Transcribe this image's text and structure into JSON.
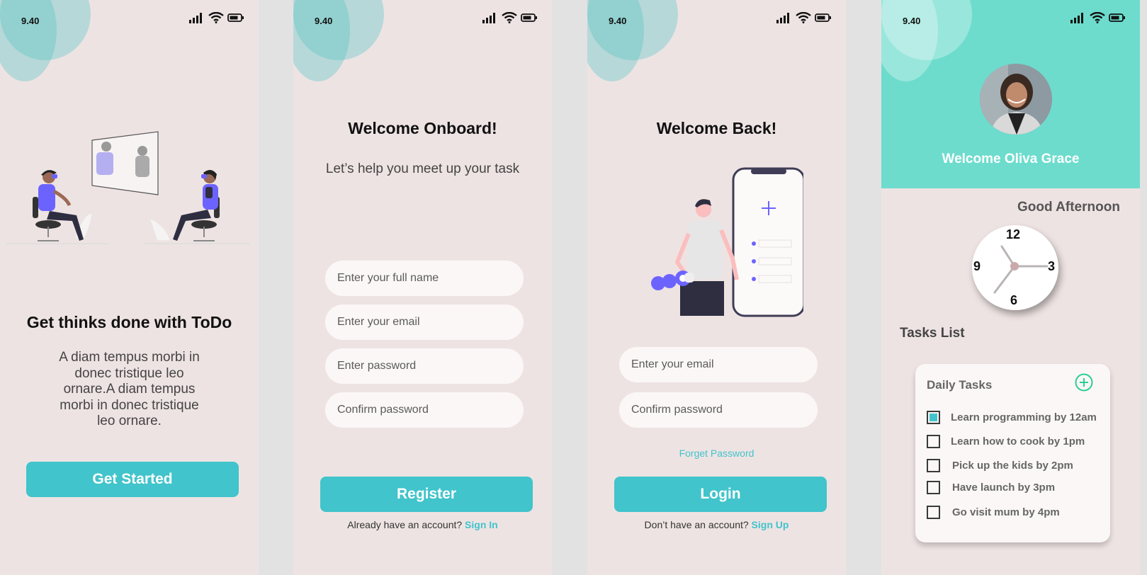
{
  "status": {
    "time": "9.40"
  },
  "onboarding": {
    "title": "Get thinks done with ToDo",
    "body": "A diam tempus morbi in donec tristique leo ornare.A diam tempus morbi in donec tristique leo ornare.",
    "cta": "Get Started"
  },
  "register": {
    "title": "Welcome Onboard!",
    "subtitle": "Let’s help you meet up your task",
    "fields": [
      "Enter your full name",
      "Enter your email",
      "Enter password",
      "Confirm password"
    ],
    "cta": "Register",
    "footer_text": "Already have an account?",
    "footer_link": "Sign  In"
  },
  "login": {
    "title": "Welcome Back!",
    "fields": [
      "Enter your email",
      "Confirm password"
    ],
    "forgot": "Forget Password",
    "cta": "Login",
    "footer_text": "Don’t have an account?",
    "footer_link": "Sign Up"
  },
  "dashboard": {
    "welcome": "Welcome Oliva Grace",
    "greeting": "Good Afternoon",
    "clock_numbers": [
      "12",
      "3",
      "6",
      "9"
    ],
    "tasks_title": "Tasks List",
    "card_title": "Daily Tasks",
    "tasks": [
      {
        "label": "Learn programming by 12am",
        "done": true
      },
      {
        "label": "Learn how to cook by 1pm",
        "done": false
      },
      {
        "label": "Pick up the kids by 2pm",
        "done": false
      },
      {
        "label": "Have launch by 3pm",
        "done": false
      },
      {
        "label": "Go visit mum by 4pm",
        "done": false
      }
    ]
  },
  "colors": {
    "accent": "#41c4cb",
    "header": "#6ddccd",
    "screen_bg": "#eee3e3",
    "field_bg": "#fcf7f7",
    "illustration_purple": "#6c63ff"
  }
}
